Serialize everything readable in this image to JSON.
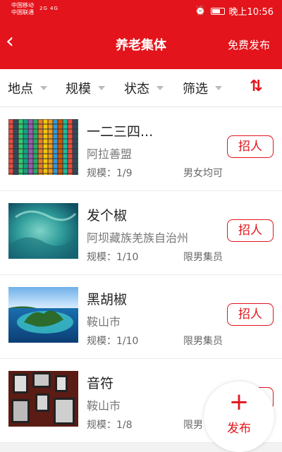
{
  "status": {
    "carrier1": "中国移动",
    "carrier2": "中国联通",
    "signal": "2G 4G",
    "time": "晚上10:56"
  },
  "header": {
    "back_icon": "chevron-left-icon",
    "title": "养老集体",
    "publish_label": "免费发布"
  },
  "filters": [
    {
      "label": "地点"
    },
    {
      "label": "规模"
    },
    {
      "label": "状态"
    },
    {
      "label": "筛选"
    }
  ],
  "sort_icon": "⇅",
  "items": [
    {
      "name": "一二三四...",
      "location": "阿拉善盟",
      "scale": "规模：1/9",
      "gender": "男女均可",
      "action": "招人",
      "thumb": "colorful-grid"
    },
    {
      "name": "发个椒",
      "location": "阿坝藏族羌族自治州",
      "scale": "规模：1/10",
      "gender": "限男集员",
      "action": "招人",
      "thumb": "teal-abstract"
    },
    {
      "name": "黑胡椒",
      "location": "鞍山市",
      "scale": "规模：1/10",
      "gender": "限男集员",
      "action": "招人",
      "thumb": "island"
    },
    {
      "name": "音符",
      "location": "鞍山市",
      "scale": "规模：1/8",
      "gender": "限男",
      "action": "招人",
      "thumb": "photo-wall"
    }
  ],
  "fab": {
    "plus": "+",
    "label": "发布"
  },
  "colors": {
    "brand": "#e3141b"
  }
}
